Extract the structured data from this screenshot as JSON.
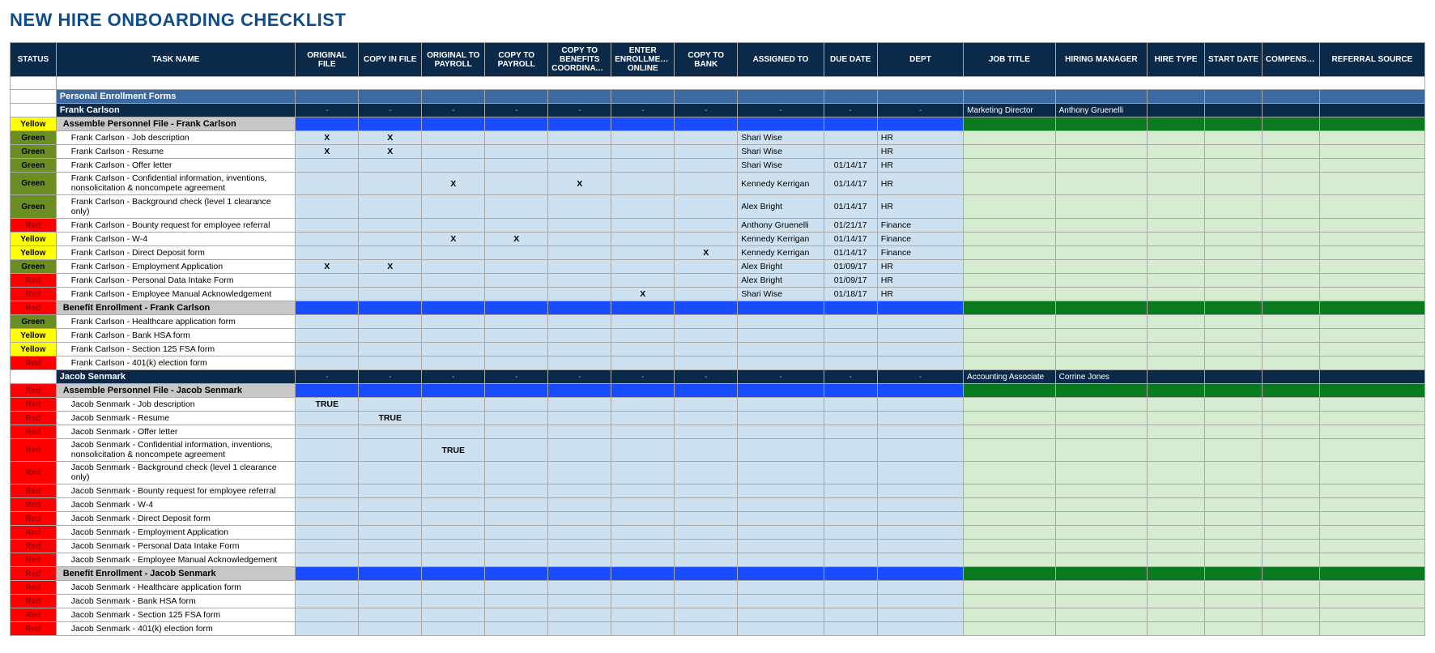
{
  "title": "NEW HIRE ONBOARDING CHECKLIST",
  "headers": [
    "STATUS",
    "TASK NAME",
    "ORIGINAL FILE",
    "COPY IN FILE",
    "ORIGINAL TO PAYROLL",
    "COPY TO PAYROLL",
    "COPY TO BENEFITS COORDINATOR",
    "ENTER ENROLLMENT ONLINE",
    "COPY TO BANK",
    "ASSIGNED TO",
    "DUE DATE",
    "DEPT",
    "JOB TITLE",
    "HIRING MANAGER",
    "HIRE TYPE",
    "START DATE",
    "COMPENSATION",
    "REFERRAL SOURCE"
  ],
  "status_labels": {
    "yellow": "Yellow",
    "green": "Green",
    "red": "Red"
  },
  "dash": "-",
  "rows": [
    {
      "type": "spacer"
    },
    {
      "type": "section",
      "label": "Personal Enrollment Forms"
    },
    {
      "type": "person",
      "name": "Frank Carlson",
      "job": "Marketing Director",
      "mgr": "Anthony Gruenelli"
    },
    {
      "type": "group",
      "status": "yellow",
      "label": "Assemble Personnel File - Frank Carlson"
    },
    {
      "type": "item",
      "status": "green",
      "task": "Frank Carlson - Job description",
      "c": [
        "X",
        "X",
        "",
        "",
        "",
        "",
        ""
      ],
      "assigned": "Shari Wise",
      "date": "",
      "dept": "HR"
    },
    {
      "type": "item",
      "status": "green",
      "task": "Frank Carlson - Resume",
      "c": [
        "X",
        "X",
        "",
        "",
        "",
        "",
        ""
      ],
      "assigned": "Shari Wise",
      "date": "",
      "dept": "HR"
    },
    {
      "type": "item",
      "status": "green",
      "task": "Frank Carlson - Offer letter",
      "c": [
        "",
        "",
        "",
        "",
        "",
        "",
        ""
      ],
      "assigned": "Shari Wise",
      "date": "01/14/17",
      "dept": "HR"
    },
    {
      "type": "item",
      "status": "green",
      "twoln": true,
      "task": "Frank Carlson - Confidential information, inventions, nonsolicitation & noncompete agreement",
      "c": [
        "",
        "",
        "X",
        "",
        "X",
        "",
        ""
      ],
      "assigned": "Kennedy Kerrigan",
      "date": "01/14/17",
      "dept": "HR"
    },
    {
      "type": "item",
      "status": "green",
      "task": "Frank Carlson - Background check (level 1 clearance only)",
      "c": [
        "",
        "",
        "",
        "",
        "",
        "",
        ""
      ],
      "assigned": "Alex Bright",
      "date": "01/14/17",
      "dept": "HR"
    },
    {
      "type": "item",
      "status": "red",
      "task": "Frank Carlson - Bounty request for employee referral",
      "c": [
        "",
        "",
        "",
        "",
        "",
        "",
        ""
      ],
      "assigned": "Anthony Gruenelli",
      "date": "01/21/17",
      "dept": "Finance"
    },
    {
      "type": "item",
      "status": "yellow",
      "task": "Frank Carlson - W-4",
      "c": [
        "",
        "",
        "X",
        "X",
        "",
        "",
        ""
      ],
      "assigned": "Kennedy Kerrigan",
      "date": "01/14/17",
      "dept": "Finance"
    },
    {
      "type": "item",
      "status": "yellow",
      "task": "Frank Carlson - Direct Deposit form",
      "c": [
        "",
        "",
        "",
        "",
        "",
        "",
        "X"
      ],
      "assigned": "Kennedy Kerrigan",
      "date": "01/14/17",
      "dept": "Finance"
    },
    {
      "type": "item",
      "status": "green",
      "task": "Frank Carlson - Employment Application",
      "c": [
        "X",
        "X",
        "",
        "",
        "",
        "",
        ""
      ],
      "assigned": "Alex Bright",
      "date": "01/09/17",
      "dept": "HR"
    },
    {
      "type": "item",
      "status": "red",
      "task": "Frank Carlson - Personal Data Intake Form",
      "c": [
        "",
        "",
        "",
        "",
        "",
        "",
        ""
      ],
      "assigned": "Alex Bright",
      "date": "01/09/17",
      "dept": "HR"
    },
    {
      "type": "item",
      "status": "red",
      "task": "Frank Carlson - Employee Manual Acknowledgement",
      "c": [
        "",
        "",
        "",
        "",
        "",
        "X",
        ""
      ],
      "assigned": "Shari Wise",
      "date": "01/18/17",
      "dept": "HR"
    },
    {
      "type": "group",
      "status": "red",
      "label": "Benefit Enrollment - Frank Carlson"
    },
    {
      "type": "item",
      "status": "green",
      "task": "Frank Carlson - Healthcare application form",
      "c": [
        "",
        "",
        "",
        "",
        "",
        "",
        ""
      ],
      "assigned": "",
      "date": "",
      "dept": ""
    },
    {
      "type": "item",
      "status": "yellow",
      "task": "Frank Carlson - Bank HSA form",
      "c": [
        "",
        "",
        "",
        "",
        "",
        "",
        ""
      ],
      "assigned": "",
      "date": "",
      "dept": ""
    },
    {
      "type": "item",
      "status": "yellow",
      "task": "Frank Carlson - Section 125 FSA form",
      "c": [
        "",
        "",
        "",
        "",
        "",
        "",
        ""
      ],
      "assigned": "",
      "date": "",
      "dept": ""
    },
    {
      "type": "item",
      "status": "red",
      "task": "Frank Carlson - 401(k) election form",
      "c": [
        "",
        "",
        "",
        "",
        "",
        "",
        ""
      ],
      "assigned": "",
      "date": "",
      "dept": ""
    },
    {
      "type": "person",
      "name": "Jacob Senmark",
      "job": "Accounting Associate",
      "mgr": "Corrine Jones"
    },
    {
      "type": "group",
      "status": "red",
      "label": "Assemble Personnel File - Jacob Senmark"
    },
    {
      "type": "item",
      "status": "red",
      "task": "Jacob Senmark - Job description",
      "c": [
        "TRUE",
        "",
        "",
        "",
        "",
        "",
        ""
      ],
      "assigned": "",
      "date": "",
      "dept": ""
    },
    {
      "type": "item",
      "status": "red",
      "task": "Jacob Senmark - Resume",
      "c": [
        "",
        "TRUE",
        "",
        "",
        "",
        "",
        ""
      ],
      "assigned": "",
      "date": "",
      "dept": ""
    },
    {
      "type": "item",
      "status": "red",
      "task": "Jacob Senmark - Offer letter",
      "c": [
        "",
        "",
        "",
        "",
        "",
        "",
        ""
      ],
      "assigned": "",
      "date": "",
      "dept": ""
    },
    {
      "type": "item",
      "status": "red",
      "twoln": true,
      "task": "Jacob Senmark - Confidential information, inventions, nonsolicitation & noncompete agreement",
      "c": [
        "",
        "",
        "TRUE",
        "",
        "",
        "",
        ""
      ],
      "assigned": "",
      "date": "",
      "dept": ""
    },
    {
      "type": "item",
      "status": "red",
      "twoln": true,
      "task": "Jacob Senmark - Background check (level 1 clearance only)",
      "c": [
        "",
        "",
        "",
        "",
        "",
        "",
        ""
      ],
      "assigned": "",
      "date": "",
      "dept": ""
    },
    {
      "type": "item",
      "status": "red",
      "task": "Jacob Senmark - Bounty request for employee referral",
      "c": [
        "",
        "",
        "",
        "",
        "",
        "",
        ""
      ],
      "assigned": "",
      "date": "",
      "dept": ""
    },
    {
      "type": "item",
      "status": "red",
      "task": "Jacob Senmark - W-4",
      "c": [
        "",
        "",
        "",
        "",
        "",
        "",
        ""
      ],
      "assigned": "",
      "date": "",
      "dept": ""
    },
    {
      "type": "item",
      "status": "red",
      "task": "Jacob Senmark - Direct Deposit form",
      "c": [
        "",
        "",
        "",
        "",
        "",
        "",
        ""
      ],
      "assigned": "",
      "date": "",
      "dept": ""
    },
    {
      "type": "item",
      "status": "red",
      "task": "Jacob Senmark - Employment Application",
      "c": [
        "",
        "",
        "",
        "",
        "",
        "",
        ""
      ],
      "assigned": "",
      "date": "",
      "dept": ""
    },
    {
      "type": "item",
      "status": "red",
      "task": "Jacob Senmark - Personal Data Intake Form",
      "c": [
        "",
        "",
        "",
        "",
        "",
        "",
        ""
      ],
      "assigned": "",
      "date": "",
      "dept": ""
    },
    {
      "type": "item",
      "status": "red",
      "task": "Jacob Senmark - Employee Manual Acknowledgement",
      "c": [
        "",
        "",
        "",
        "",
        "",
        "",
        ""
      ],
      "assigned": "",
      "date": "",
      "dept": ""
    },
    {
      "type": "group",
      "status": "red",
      "label": "Benefit Enrollment - Jacob Senmark"
    },
    {
      "type": "item",
      "status": "red",
      "task": "Jacob Senmark - Healthcare application form",
      "c": [
        "",
        "",
        "",
        "",
        "",
        "",
        ""
      ],
      "assigned": "",
      "date": "",
      "dept": ""
    },
    {
      "type": "item",
      "status": "red",
      "task": "Jacob Senmark - Bank HSA form",
      "c": [
        "",
        "",
        "",
        "",
        "",
        "",
        ""
      ],
      "assigned": "",
      "date": "",
      "dept": ""
    },
    {
      "type": "item",
      "status": "red",
      "task": "Jacob Senmark - Section 125 FSA form",
      "c": [
        "",
        "",
        "",
        "",
        "",
        "",
        ""
      ],
      "assigned": "",
      "date": "",
      "dept": ""
    },
    {
      "type": "item",
      "status": "red",
      "task": "Jacob Senmark - 401(k) election form",
      "c": [
        "",
        "",
        "",
        "",
        "",
        "",
        ""
      ],
      "assigned": "",
      "date": "",
      "dept": ""
    }
  ]
}
